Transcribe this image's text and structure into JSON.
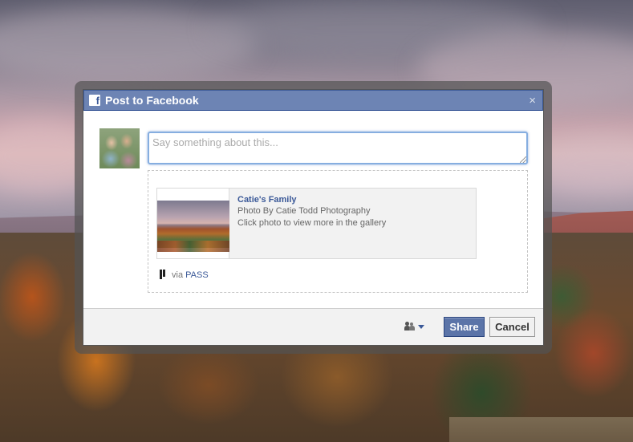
{
  "dialog": {
    "title": "Post to Facebook",
    "title_icon": "facebook-icon",
    "close_icon": "close-icon",
    "close_glyph": "×"
  },
  "composer": {
    "placeholder": "Say something about this...",
    "value": ""
  },
  "attachment": {
    "title": "Catie's Family",
    "byline": "Photo By Catie Todd Photography",
    "caption": "Click photo to view more in the gallery",
    "thumbnail_icon": "landscape-photo"
  },
  "via": {
    "prefix": "via",
    "app_name": "PASS",
    "app_icon": "pass-logo-icon"
  },
  "footer": {
    "audience_icon": "friends-icon",
    "share_label": "Share",
    "cancel_label": "Cancel"
  },
  "colors": {
    "facebook_blue": "#6d84b4",
    "facebook_dark_blue": "#3b5998",
    "share_button": "#5b74a8",
    "footer_bg": "#f2f2f2"
  }
}
